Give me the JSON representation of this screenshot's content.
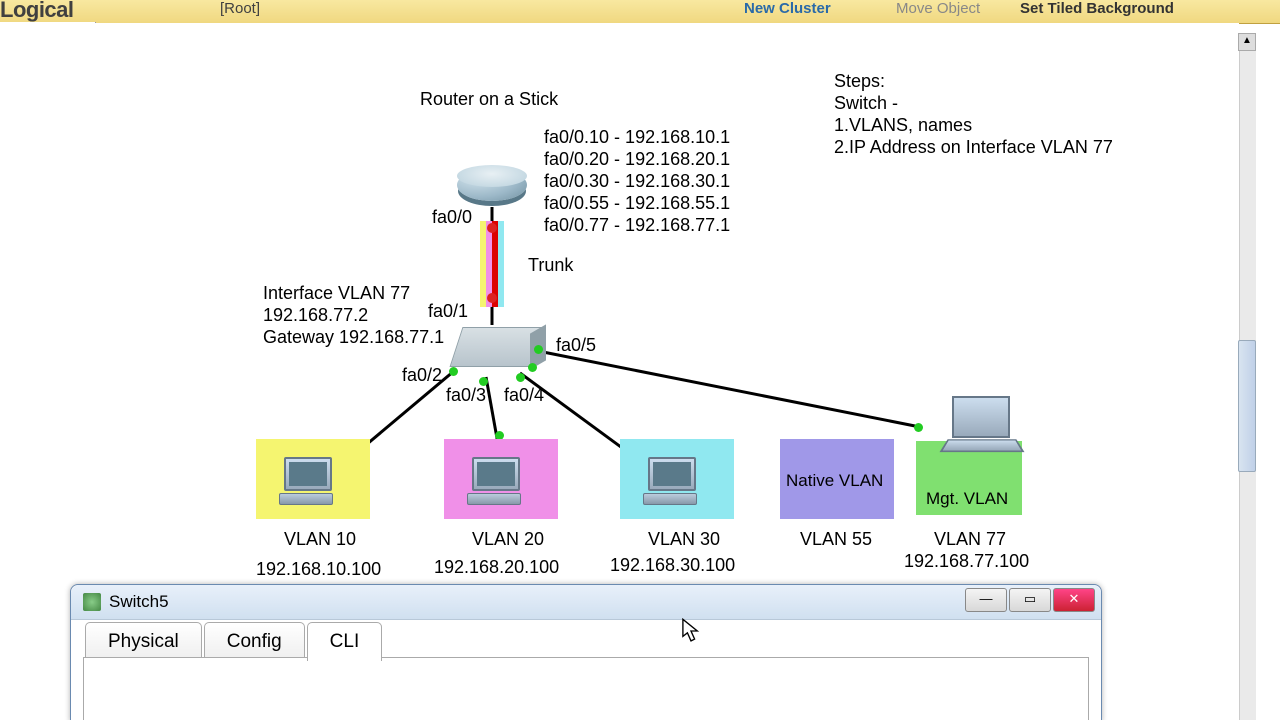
{
  "toolbar": {
    "logical": "Logical",
    "root": "[Root]",
    "newCluster": "New Cluster",
    "moveObject": "Move Object",
    "setTiled": "Set Tiled Background"
  },
  "diagram": {
    "title": "Router on a Stick",
    "routerIfs": [
      "fa0/0.10 - 192.168.10.1",
      "fa0/0.20 - 192.168.20.1",
      "fa0/0.30 - 192.168.30.1",
      "fa0/0.55 - 192.168.55.1",
      "fa0/0.77 - 192.168.77.1"
    ],
    "routerPort": "fa0/0",
    "trunk": "Trunk",
    "switchIf": {
      "line1": "Interface VLAN 77",
      "line2": "192.168.77.2",
      "line3": "Gateway 192.168.77.1"
    },
    "switchPorts": {
      "uplink": "fa0/1",
      "p2": "fa0/2",
      "p3": "fa0/3",
      "p4": "fa0/4",
      "p5": "fa0/5"
    },
    "hosts": [
      {
        "name": "VLAN 10",
        "ip": "192.168.10.100"
      },
      {
        "name": "VLAN 20",
        "ip": "192.168.20.100"
      },
      {
        "name": "VLAN 30",
        "ip": "192.168.30.100"
      },
      {
        "name": "VLAN 55",
        "ip": ""
      },
      {
        "name": "VLAN 77",
        "ip": "192.168.77.100"
      }
    ],
    "nativeVlan": "Native VLAN",
    "mgtVlan": "Mgt. VLAN",
    "steps": {
      "head": "Steps:",
      "l1": "Switch -",
      "l2": "1.VLANS, names",
      "l3": "2.IP Address on Interface VLAN 77"
    }
  },
  "window": {
    "title": "Switch5",
    "tabs": [
      "Physical",
      "Config",
      "CLI"
    ],
    "activeTab": "CLI"
  }
}
